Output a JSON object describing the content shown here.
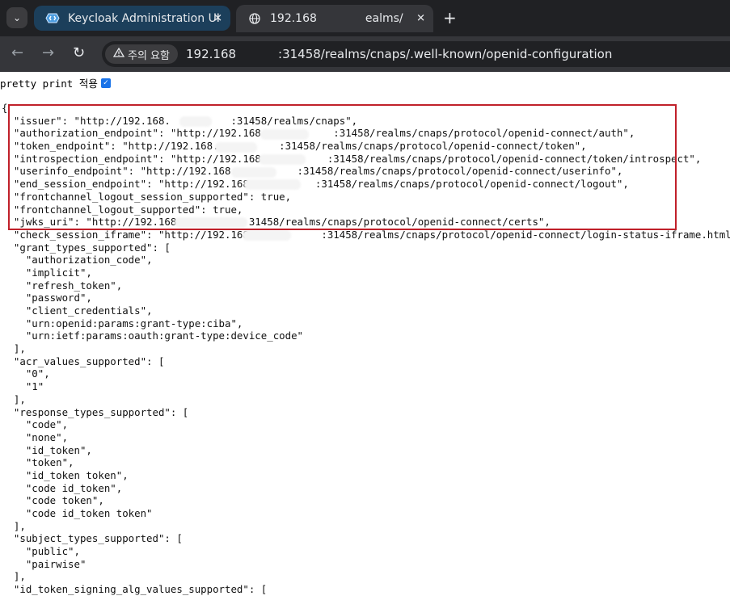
{
  "tabs": [
    {
      "title": "Keycloak Administration UI",
      "favicon": "keycloak-icon",
      "close": "✕"
    },
    {
      "title": "192.168",
      "title_tail": "ealms/",
      "favicon": "globe-icon",
      "close": "✕"
    }
  ],
  "tab_menu_icon": "⌄",
  "new_tab": "+",
  "toolbar": {
    "back": "←",
    "forward": "→",
    "reload": "↻",
    "security_label": "주의 요함",
    "security_icon": "warning-triangle-icon",
    "url_start": "192.168",
    "url_end": ":31458/realms/cnaps/.well-known/openid-configuration"
  },
  "pretty_print": {
    "label": "pretty print 적용",
    "checked": true
  },
  "json_lines": [
    "{",
    "  \"issuer\": \"http://192.168.          :31458/realms/cnaps\",",
    "  \"authorization_endpoint\": \"http://192.168.           :31458/realms/cnaps/protocol/openid-connect/auth\",",
    "  \"token_endpoint\": \"http://192.168.          :31458/realms/cnaps/protocol/openid-connect/token\",",
    "  \"introspection_endpoint\": \"http://192.168           :31458/realms/cnaps/protocol/openid-connect/token/introspect\",",
    "  \"userinfo_endpoint\": \"http://192.168.          :31458/realms/cnaps/protocol/openid-connect/userinfo\",",
    "  \"end_session_endpoint\": \"http://192.168           :31458/realms/cnaps/protocol/openid-connect/logout\",",
    "  \"frontchannel_logout_session_supported\": true,",
    "  \"frontchannel_logout_supported\": true,",
    "  \"jwks_uri\": \"http://192.168.           31458/realms/cnaps/protocol/openid-connect/certs\",",
    "  \"check_session_iframe\": \"http://192.168            :31458/realms/cnaps/protocol/openid-connect/login-status-iframe.html\",",
    "  \"grant_types_supported\": [",
    "    \"authorization_code\",",
    "    \"implicit\",",
    "    \"refresh_token\",",
    "    \"password\",",
    "    \"client_credentials\",",
    "    \"urn:openid:params:grant-type:ciba\",",
    "    \"urn:ietf:params:oauth:grant-type:device_code\"",
    "  ],",
    "  \"acr_values_supported\": [",
    "    \"0\",",
    "    \"1\"",
    "  ],",
    "  \"response_types_supported\": [",
    "    \"code\",",
    "    \"none\",",
    "    \"id_token\",",
    "    \"token\",",
    "    \"id_token token\",",
    "    \"code id_token\",",
    "    \"code token\",",
    "    \"code id_token token\"",
    "  ],",
    "  \"subject_types_supported\": [",
    "    \"public\",",
    "    \"pairwise\"",
    "  ],",
    "  \"id_token_signing_alg_values_supported\": ["
  ],
  "colors": {
    "highlight_box": "#c0202a",
    "tab_active": "#1c3f5b",
    "checkbox": "#1a73e8"
  }
}
